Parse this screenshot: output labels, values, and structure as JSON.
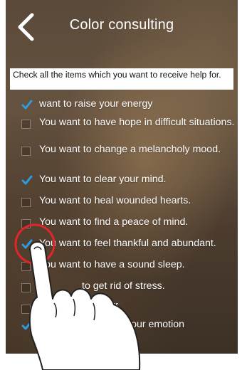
{
  "header": {
    "title": "Color consulting"
  },
  "instructions": "Check all the items which you want to receive help for.",
  "items": [
    {
      "label": "want to raise your energy",
      "checked": true
    },
    {
      "label": "You want to have hope in difficult situations.",
      "checked": false
    },
    {
      "label": "You want to change a melancholy mood.",
      "checked": false
    },
    {
      "label": "You want to clear your mind.",
      "checked": true
    },
    {
      "label": "You want to heal wounded hearts.",
      "checked": false
    },
    {
      "label": "You want to find a peace of mind.",
      "checked": false
    },
    {
      "label": "You want to feel thankful and abundant.",
      "checked": true
    },
    {
      "label": "You want to have a sound sleep.",
      "checked": false
    },
    {
      "label": "to get rid of stress.",
      "checked": false
    },
    {
      "label": "off.",
      "checked": false
    },
    {
      "label": "your emotion",
      "checked": true
    }
  ],
  "colors": {
    "check": "#2f9ae0",
    "tap_circle": "#e0262b",
    "header_text": "#ffffff"
  }
}
